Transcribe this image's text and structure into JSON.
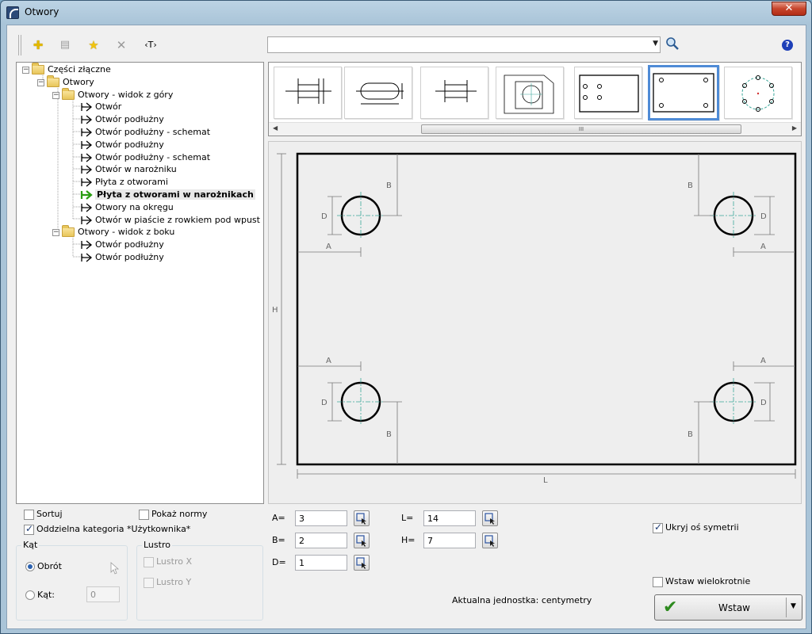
{
  "window": {
    "title": "Otwory",
    "close_label": "✕"
  },
  "toolbar": {
    "buttons": [
      {
        "name": "add-icon",
        "glyph": "✚"
      },
      {
        "name": "properties-icon",
        "glyph": "▤"
      },
      {
        "name": "favorite-icon",
        "glyph": "★"
      },
      {
        "name": "delete-icon",
        "glyph": "✕"
      },
      {
        "name": "text-tag-icon",
        "glyph": "‹T›"
      }
    ],
    "search_value": "",
    "help_label": "?"
  },
  "tree": {
    "root": "Części złączne",
    "folder_otwory": "Otwory",
    "folder_top": "Otwory - widok z góry",
    "top_items": [
      "Otwór",
      "Otwór podłużny",
      "Otwór podłużny - schemat",
      "Otwór podłużny",
      "Otwór podłużny - schemat",
      "Otwór w narożniku",
      "Płyta z otworami",
      "Płyta z otworami w narożnikach",
      "Otwory na okręgu",
      "Otwór w piaście z rowkiem pod wpust"
    ],
    "selected_index": 7,
    "folder_side": "Otwory - widok z boku",
    "side_items": [
      "Otwór podłużny",
      "Otwór podłużny"
    ]
  },
  "thumbnails": {
    "count": 7,
    "selected_index": 5,
    "scroll_grip": "III"
  },
  "preview": {
    "dim_A": "A",
    "dim_B": "B",
    "dim_D": "D",
    "dim_H": "H",
    "dim_L": "L",
    "outline_color": "#000000",
    "axis_color": "#3aa79a"
  },
  "options": {
    "sort": {
      "label": "Sortuj",
      "checked": false
    },
    "show_norms": {
      "label": "Pokaż normy",
      "checked": false
    },
    "separate_category": {
      "label": "Oddzielna kategoria *Użytkownika*",
      "checked": true
    },
    "hide_symmetry": {
      "label": "Ukryj oś symetrii",
      "checked": true
    },
    "insert_multiple": {
      "label": "Wstaw wielokrotnie",
      "checked": false
    }
  },
  "angle_group": {
    "title": "Kąt",
    "rotation_label": "Obrót",
    "angle_label": "Kąt:",
    "angle_value": "0",
    "selected": "rotation"
  },
  "mirror_group": {
    "title": "Lustro",
    "mirror_x": "Lustro X",
    "mirror_y": "Lustro Y"
  },
  "params": {
    "A": {
      "label": "A=",
      "value": "3"
    },
    "B": {
      "label": "B=",
      "value": "2"
    },
    "D": {
      "label": "D=",
      "value": "1"
    },
    "L": {
      "label": "L=",
      "value": "14"
    },
    "H": {
      "label": "H=",
      "value": "7"
    }
  },
  "unit_text": "Aktualna jednostka: centymetry",
  "insert_button": {
    "label": "Wstaw"
  }
}
